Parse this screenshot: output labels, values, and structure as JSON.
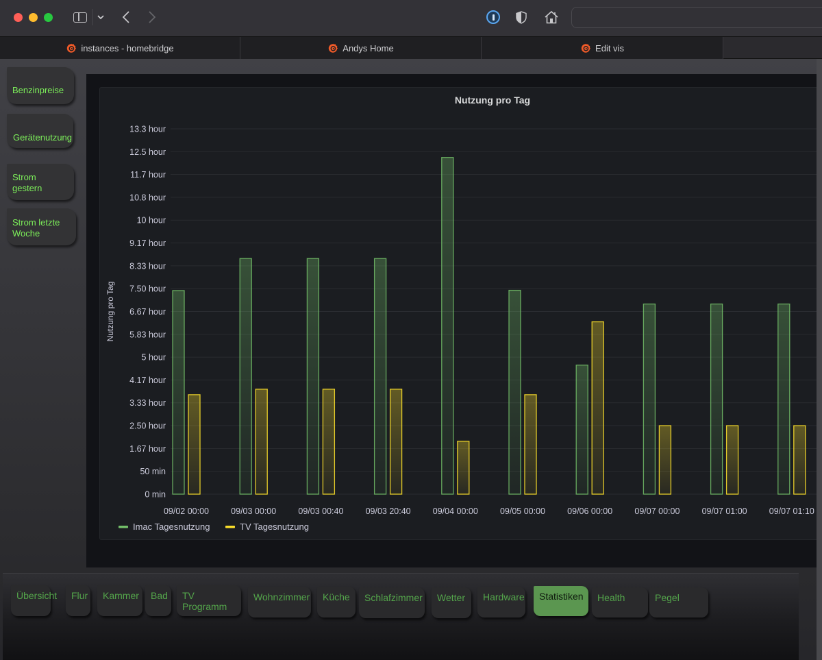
{
  "browser": {
    "toolbar_icons": [
      "sidebar-toggle-icon",
      "chevron-down-icon",
      "back-arrow-icon",
      "forward-arrow-icon",
      "onepassword-icon",
      "shield-icon",
      "home-icon"
    ],
    "address_value": "",
    "tabs": [
      {
        "label": "instances - homebridge",
        "icon": "grafana-icon"
      },
      {
        "label": "Andys Home",
        "icon": "grafana-icon"
      },
      {
        "label": "Edit vis",
        "icon": "grafana-icon"
      }
    ],
    "glyphs": {
      "chevron_down": "⌄",
      "back": "‹",
      "forward": "›"
    }
  },
  "sidebar": {
    "items": [
      {
        "label": "Benzinpreise"
      },
      {
        "label": "Gerätenutzung"
      },
      {
        "label": "Strom gestern"
      },
      {
        "label": "Strom letzte Woche"
      }
    ]
  },
  "bottom_nav": {
    "active": "Statistiken",
    "items": [
      {
        "label": "Übersicht"
      },
      {
        "label": "Flur"
      },
      {
        "label": "Kammer"
      },
      {
        "label": "Bad"
      },
      {
        "label": "TV Programm"
      },
      {
        "label": "Wohnzimmer"
      },
      {
        "label": "Küche"
      },
      {
        "label": "Schlafzimmer"
      },
      {
        "label": "Wetter"
      },
      {
        "label": "Hardware"
      },
      {
        "label": "Statistiken"
      },
      {
        "label": "Health"
      },
      {
        "label": "Pegel"
      }
    ]
  },
  "colors": {
    "imac": "#73bf69",
    "tv": "#fade2a",
    "sidebar_text": "#7df05a",
    "nav_text": "#54a64b",
    "nav_active_bg": "#5b9650"
  },
  "chart_data": {
    "type": "bar",
    "title": "Nutzung pro Tag",
    "ylabel": "Nutzung pro Tag",
    "xlabel": "",
    "unit": "hours",
    "ylim": [
      0,
      13.333
    ],
    "yticks": [
      0,
      0.8333,
      1.6667,
      2.5,
      3.3333,
      4.1667,
      5,
      5.8333,
      6.6667,
      7.5,
      8.3333,
      9.1667,
      10,
      10.8333,
      11.6667,
      12.5,
      13.3333
    ],
    "ytick_labels": [
      "0 min",
      "50 min",
      "1.67 hour",
      "2.50 hour",
      "3.33 hour",
      "4.17 hour",
      "5 hour",
      "5.83 hour",
      "6.67 hour",
      "7.50 hour",
      "8.33 hour",
      "9.17 hour",
      "10 hour",
      "10.8 hour",
      "11.7 hour",
      "12.5 hour",
      "13.3 hour"
    ],
    "categories": [
      "09/02 00:00",
      "09/03 00:00",
      "09/03 00:40",
      "09/03 20:40",
      "09/04 00:00",
      "09/05 00:00",
      "09/06 00:00",
      "09/07 00:00",
      "09/07 01:00",
      "09/07 01:10"
    ],
    "grid": true,
    "legend_position": "bottom-left",
    "series": [
      {
        "name": "Imac Tagesnutzung",
        "color": "#73bf69",
        "values": [
          7.43,
          8.6,
          8.6,
          8.6,
          12.29,
          7.44,
          4.71,
          6.94,
          6.94,
          6.94
        ]
      },
      {
        "name": "TV Tagesnutzung",
        "color": "#fade2a",
        "values": [
          3.63,
          3.83,
          3.83,
          3.83,
          1.93,
          3.63,
          6.29,
          2.5,
          2.5,
          2.5
        ]
      }
    ]
  }
}
